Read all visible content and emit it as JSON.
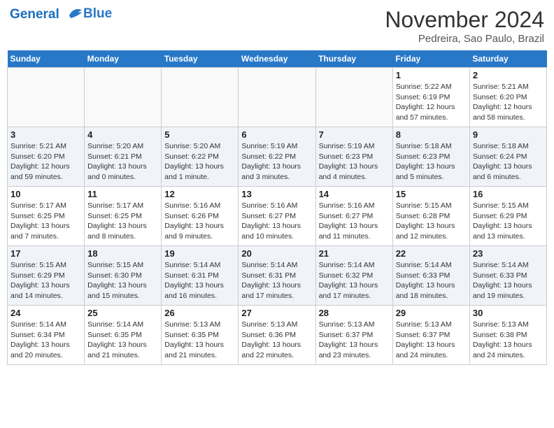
{
  "header": {
    "logo_line1": "General",
    "logo_line2": "Blue",
    "month": "November 2024",
    "location": "Pedreira, Sao Paulo, Brazil"
  },
  "weekdays": [
    "Sunday",
    "Monday",
    "Tuesday",
    "Wednesday",
    "Thursday",
    "Friday",
    "Saturday"
  ],
  "weeks": [
    [
      {
        "day": "",
        "info": ""
      },
      {
        "day": "",
        "info": ""
      },
      {
        "day": "",
        "info": ""
      },
      {
        "day": "",
        "info": ""
      },
      {
        "day": "",
        "info": ""
      },
      {
        "day": "1",
        "info": "Sunrise: 5:22 AM\nSunset: 6:19 PM\nDaylight: 12 hours and 57 minutes."
      },
      {
        "day": "2",
        "info": "Sunrise: 5:21 AM\nSunset: 6:20 PM\nDaylight: 12 hours and 58 minutes."
      }
    ],
    [
      {
        "day": "3",
        "info": "Sunrise: 5:21 AM\nSunset: 6:20 PM\nDaylight: 12 hours and 59 minutes."
      },
      {
        "day": "4",
        "info": "Sunrise: 5:20 AM\nSunset: 6:21 PM\nDaylight: 13 hours and 0 minutes."
      },
      {
        "day": "5",
        "info": "Sunrise: 5:20 AM\nSunset: 6:22 PM\nDaylight: 13 hours and 1 minute."
      },
      {
        "day": "6",
        "info": "Sunrise: 5:19 AM\nSunset: 6:22 PM\nDaylight: 13 hours and 3 minutes."
      },
      {
        "day": "7",
        "info": "Sunrise: 5:19 AM\nSunset: 6:23 PM\nDaylight: 13 hours and 4 minutes."
      },
      {
        "day": "8",
        "info": "Sunrise: 5:18 AM\nSunset: 6:23 PM\nDaylight: 13 hours and 5 minutes."
      },
      {
        "day": "9",
        "info": "Sunrise: 5:18 AM\nSunset: 6:24 PM\nDaylight: 13 hours and 6 minutes."
      }
    ],
    [
      {
        "day": "10",
        "info": "Sunrise: 5:17 AM\nSunset: 6:25 PM\nDaylight: 13 hours and 7 minutes."
      },
      {
        "day": "11",
        "info": "Sunrise: 5:17 AM\nSunset: 6:25 PM\nDaylight: 13 hours and 8 minutes."
      },
      {
        "day": "12",
        "info": "Sunrise: 5:16 AM\nSunset: 6:26 PM\nDaylight: 13 hours and 9 minutes."
      },
      {
        "day": "13",
        "info": "Sunrise: 5:16 AM\nSunset: 6:27 PM\nDaylight: 13 hours and 10 minutes."
      },
      {
        "day": "14",
        "info": "Sunrise: 5:16 AM\nSunset: 6:27 PM\nDaylight: 13 hours and 11 minutes."
      },
      {
        "day": "15",
        "info": "Sunrise: 5:15 AM\nSunset: 6:28 PM\nDaylight: 13 hours and 12 minutes."
      },
      {
        "day": "16",
        "info": "Sunrise: 5:15 AM\nSunset: 6:29 PM\nDaylight: 13 hours and 13 minutes."
      }
    ],
    [
      {
        "day": "17",
        "info": "Sunrise: 5:15 AM\nSunset: 6:29 PM\nDaylight: 13 hours and 14 minutes."
      },
      {
        "day": "18",
        "info": "Sunrise: 5:15 AM\nSunset: 6:30 PM\nDaylight: 13 hours and 15 minutes."
      },
      {
        "day": "19",
        "info": "Sunrise: 5:14 AM\nSunset: 6:31 PM\nDaylight: 13 hours and 16 minutes."
      },
      {
        "day": "20",
        "info": "Sunrise: 5:14 AM\nSunset: 6:31 PM\nDaylight: 13 hours and 17 minutes."
      },
      {
        "day": "21",
        "info": "Sunrise: 5:14 AM\nSunset: 6:32 PM\nDaylight: 13 hours and 17 minutes."
      },
      {
        "day": "22",
        "info": "Sunrise: 5:14 AM\nSunset: 6:33 PM\nDaylight: 13 hours and 18 minutes."
      },
      {
        "day": "23",
        "info": "Sunrise: 5:14 AM\nSunset: 6:33 PM\nDaylight: 13 hours and 19 minutes."
      }
    ],
    [
      {
        "day": "24",
        "info": "Sunrise: 5:14 AM\nSunset: 6:34 PM\nDaylight: 13 hours and 20 minutes."
      },
      {
        "day": "25",
        "info": "Sunrise: 5:14 AM\nSunset: 6:35 PM\nDaylight: 13 hours and 21 minutes."
      },
      {
        "day": "26",
        "info": "Sunrise: 5:13 AM\nSunset: 6:35 PM\nDaylight: 13 hours and 21 minutes."
      },
      {
        "day": "27",
        "info": "Sunrise: 5:13 AM\nSunset: 6:36 PM\nDaylight: 13 hours and 22 minutes."
      },
      {
        "day": "28",
        "info": "Sunrise: 5:13 AM\nSunset: 6:37 PM\nDaylight: 13 hours and 23 minutes."
      },
      {
        "day": "29",
        "info": "Sunrise: 5:13 AM\nSunset: 6:37 PM\nDaylight: 13 hours and 24 minutes."
      },
      {
        "day": "30",
        "info": "Sunrise: 5:13 AM\nSunset: 6:38 PM\nDaylight: 13 hours and 24 minutes."
      }
    ]
  ]
}
